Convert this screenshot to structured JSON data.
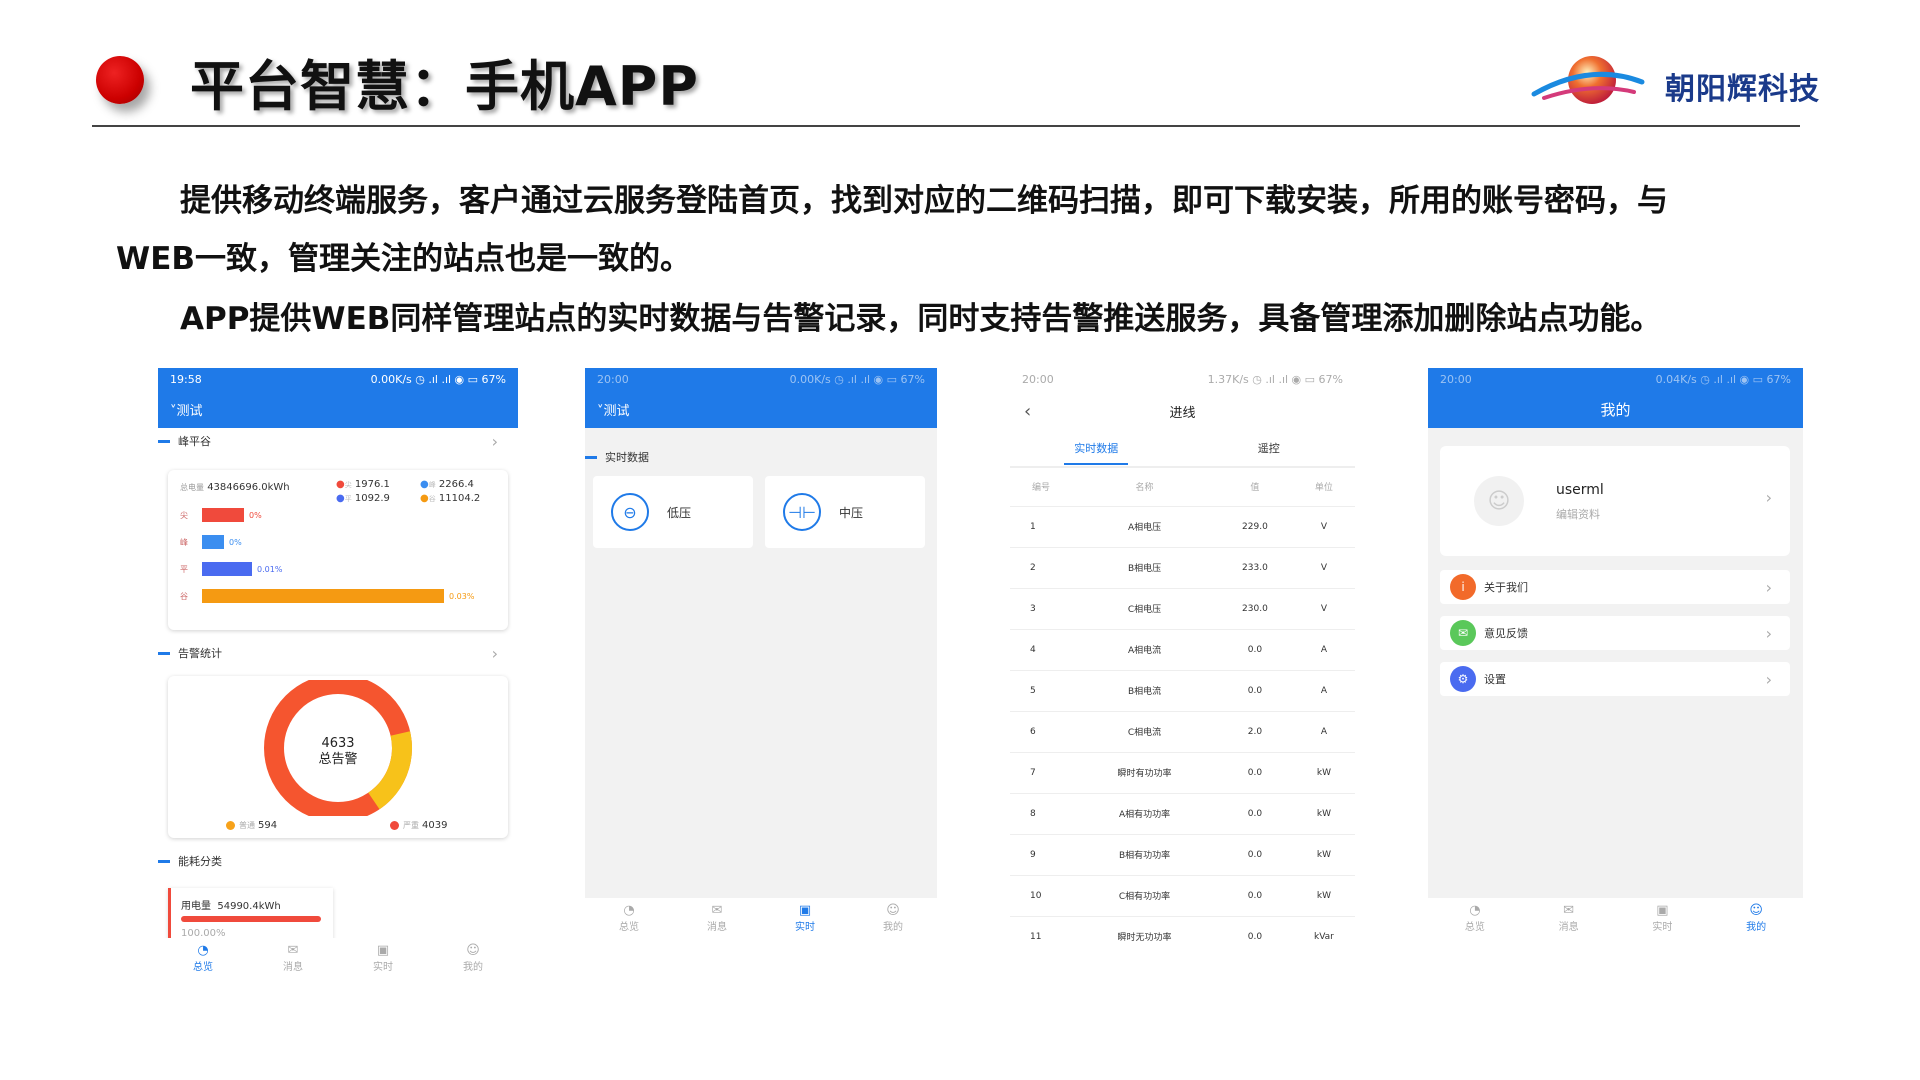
{
  "header": {
    "title": "平台智慧：手机APP",
    "brand": "朝阳辉科技"
  },
  "paragraphs": {
    "p1a": "提供移动终端服务，客户通过云服务登陆首页，找到对应的二维码扫描，即可下载安装，所用的账号密码，与",
    "p1b": "WEB一致，管理关注的站点也是一致的。",
    "p2": "APP提供WEB同样管理站点的实时数据与告警记录，同时支持告警推送服务，具备管理添加删除站点功能。"
  },
  "phone1": {
    "time": "19:58",
    "status": "0.00K/s ◷ .ıl .ıl ◉ ▭ 67%",
    "station": "˅测试",
    "sec1": "峰平谷",
    "total_label": "总电量",
    "total_value": "43846696.0kWh",
    "legend": [
      {
        "k": "尖",
        "v": "1976.1"
      },
      {
        "k": "峰",
        "v": "2266.4"
      },
      {
        "k": "平",
        "v": "1092.9"
      },
      {
        "k": "谷",
        "v": "11104.2"
      }
    ],
    "bars": [
      {
        "k": "尖",
        "pct": "0%",
        "value": 0
      },
      {
        "k": "峰",
        "pct": "0%",
        "value": 0
      },
      {
        "k": "平",
        "pct": "0.01%",
        "value": 0.01
      },
      {
        "k": "谷",
        "pct": "0.03%",
        "value": 0.03
      }
    ],
    "sec2": "告警统计",
    "alarm_total": "4633",
    "alarm_total_label": "总告警",
    "normal_label": "普通",
    "normal_value": "594",
    "serious_label": "严重",
    "serious_value": "4039",
    "sec3": "能耗分类",
    "energy_label": "用电量",
    "energy_value": "54990.4kWh",
    "energy_pct": "100.00%",
    "colors": {
      "jian": "#f04a3c",
      "feng": "#3b8ef0",
      "ping": "#4a6bf0",
      "gu": "#f59a12"
    }
  },
  "tabs": [
    {
      "icon": "◔",
      "label": "总览"
    },
    {
      "icon": "✉",
      "label": "消息"
    },
    {
      "icon": "▣",
      "label": "实时"
    },
    {
      "icon": "☺",
      "label": "我的"
    }
  ],
  "phone2": {
    "time": "20:00",
    "status": "0.00K/s ◷ .ıl .ıl ◉ ▭ 67%",
    "station": "˅测试",
    "sec": "实时数据",
    "card1": "低压",
    "card2": "中压"
  },
  "phone3": {
    "time": "20:00",
    "status": "1.37K/s ◷ .ıl .ıl ◉ ▭ 67%",
    "title": "进线",
    "tab1": "实时数据",
    "tab2": "遥控",
    "columns": [
      "编号",
      "名称",
      "值",
      "单位"
    ],
    "rows": [
      [
        "1",
        "A相电压",
        "229.0",
        "V"
      ],
      [
        "2",
        "B相电压",
        "233.0",
        "V"
      ],
      [
        "3",
        "C相电压",
        "230.0",
        "V"
      ],
      [
        "4",
        "A相电流",
        "0.0",
        "A"
      ],
      [
        "5",
        "B相电流",
        "0.0",
        "A"
      ],
      [
        "6",
        "C相电流",
        "2.0",
        "A"
      ],
      [
        "7",
        "瞬时有功功率",
        "0.0",
        "kW"
      ],
      [
        "8",
        "A相有功功率",
        "0.0",
        "kW"
      ],
      [
        "9",
        "B相有功功率",
        "0.0",
        "kW"
      ],
      [
        "10",
        "C相有功功率",
        "0.0",
        "kW"
      ],
      [
        "11",
        "瞬时无功功率",
        "0.0",
        "kVar"
      ]
    ]
  },
  "phone4": {
    "time": "20:00",
    "status": "0.04K/s ◷ .ıl .ıl ◉ ▭ 67%",
    "title": "我的",
    "username": "userml",
    "edit": "编辑资料",
    "menu": [
      "关于我们",
      "意见反馈",
      "设置"
    ]
  }
}
